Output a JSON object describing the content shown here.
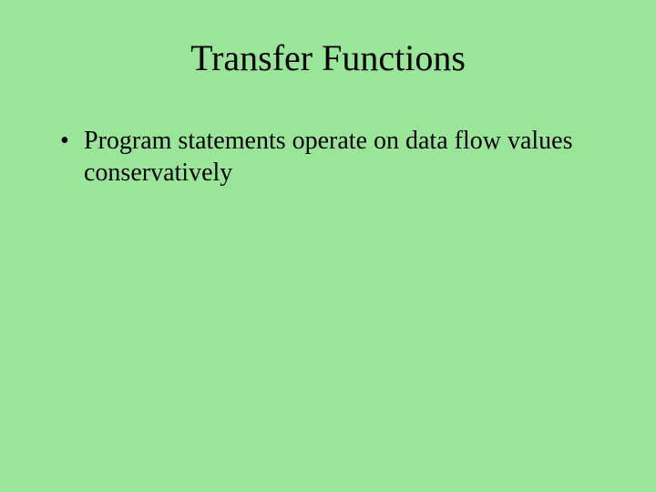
{
  "slide": {
    "title": "Transfer Functions",
    "bullets": [
      "Program statements operate on data flow values conservatively"
    ]
  }
}
